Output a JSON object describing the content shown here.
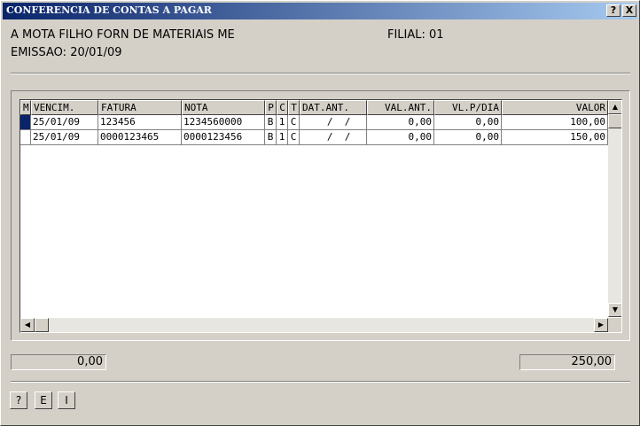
{
  "window": {
    "title": "CONFERENCIA DE CONTAS A PAGAR",
    "help_button": "?",
    "close_button": "X"
  },
  "header": {
    "supplier": "A MOTA FILHO FORN DE MATERIAIS ME",
    "branch": "FILIAL: 01",
    "issue_date": "EMISSAO: 20/01/09"
  },
  "grid": {
    "columns": [
      "M",
      "VENCIM.",
      "FATURA",
      "NOTA",
      "P",
      "C",
      "T",
      "DAT.ANT.",
      "VAL.ANT.",
      "VL.P/DIA",
      "VALOR"
    ],
    "rows": [
      [
        "",
        "25/01/09",
        "123456",
        "1234560000",
        "B",
        "1",
        "C",
        "  /  /",
        "0,00",
        "0,00",
        "100,00"
      ],
      [
        "",
        "25/01/09",
        "0000123465",
        "0000123456",
        "B",
        "1",
        "C",
        "  /  /",
        "0,00",
        "0,00",
        "150,00"
      ]
    ],
    "selected_row": 0
  },
  "totals": {
    "left": "0,00",
    "right": "250,00"
  },
  "buttons": {
    "help": "?",
    "edit": "E",
    "info": "I"
  },
  "colors": {
    "title_start": "#0a246a",
    "title_end": "#a6caf0",
    "face": "#d4d0c8",
    "selection_marker": "#0a246a"
  }
}
